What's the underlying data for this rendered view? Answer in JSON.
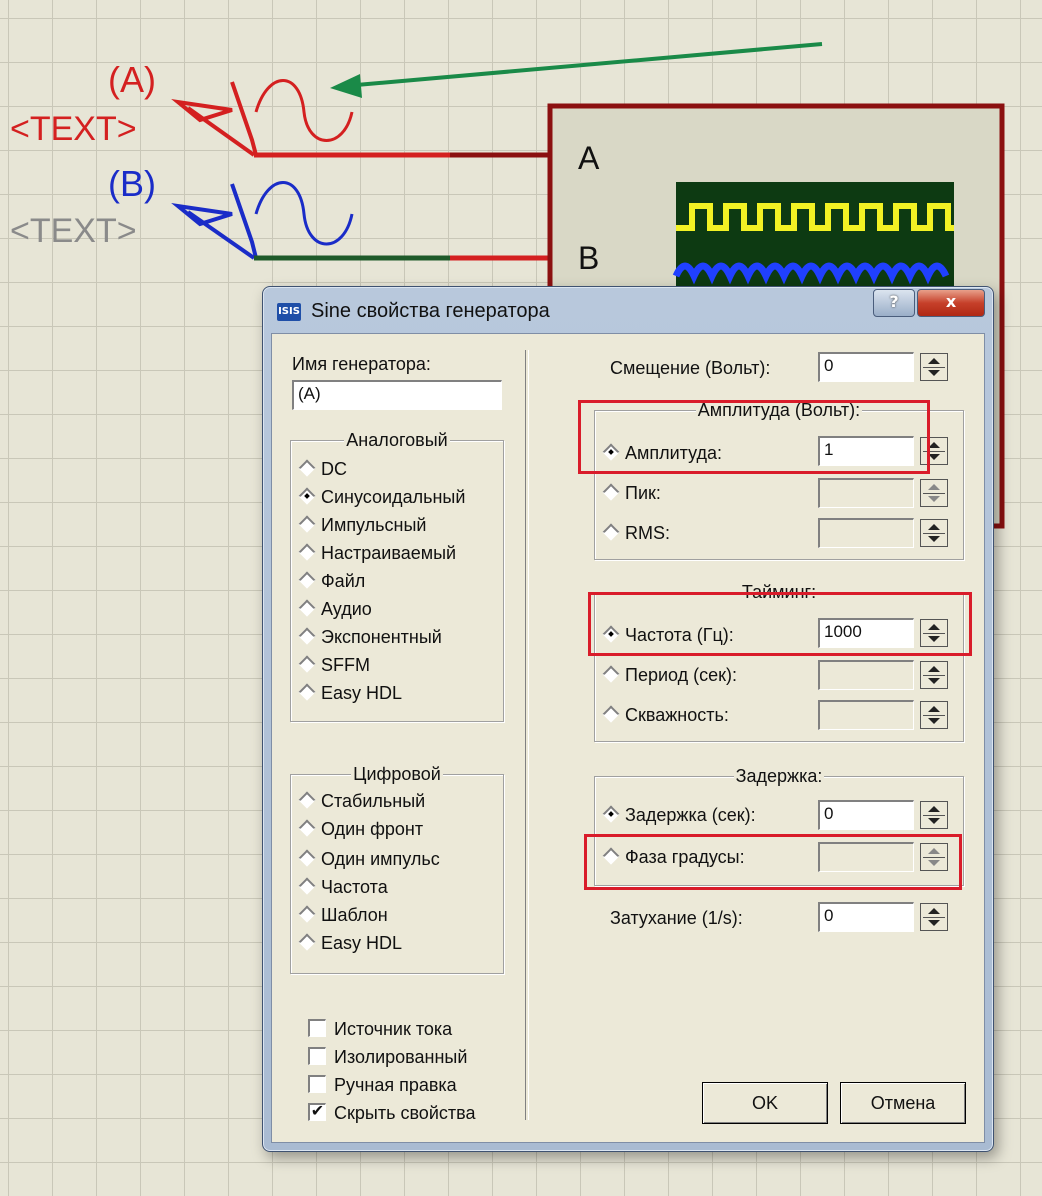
{
  "schematic": {
    "gen_a": {
      "name": "(A)",
      "text": "<TEXT>"
    },
    "gen_b": {
      "name": "(B)",
      "text": "<TEXT>"
    },
    "scope": {
      "channel_a": "A",
      "channel_b": "B"
    }
  },
  "dialog": {
    "icon_text": "ISIS",
    "title": "Sine свойства генератора",
    "help_label": "?",
    "close_label": "x",
    "generator_name_label": "Имя генератора:",
    "generator_name_value": "(A)",
    "analog": {
      "title": "Аналоговый",
      "options": [
        "DC",
        "Синусоидальный",
        "Импульсный",
        "Настраиваемый",
        "Файл",
        "Аудио",
        "Экспонентный",
        "SFFM",
        "Easy HDL"
      ],
      "selected": 1
    },
    "digital": {
      "title": "Цифровой",
      "options": [
        "Стабильный",
        "Один фронт",
        "Один импульс",
        "Частота",
        "Шаблон",
        "Easy HDL"
      ]
    },
    "checkboxes": [
      {
        "label": "Источник тока",
        "checked": false
      },
      {
        "label": "Изолированный",
        "checked": false
      },
      {
        "label": "Ручная правка",
        "checked": false
      },
      {
        "label": "Скрыть свойства",
        "checked": true,
        "mark": "✔"
      }
    ],
    "offset": {
      "label": "Смещение (Вольт):",
      "value": "0"
    },
    "amplitude_group": {
      "title": "Амплитуда (Вольт):",
      "amplitude": {
        "label": "Амплитуда:",
        "value": "1"
      },
      "peak": {
        "label": "Пик:",
        "value": ""
      },
      "rms": {
        "label": "RMS:",
        "value": ""
      }
    },
    "timing_group": {
      "title": "Тайминг:",
      "frequency": {
        "label": "Частота (Гц):",
        "value": "1000"
      },
      "period": {
        "label": "Период (сек):",
        "value": ""
      },
      "duty": {
        "label": "Скважность:",
        "value": ""
      }
    },
    "delay_group": {
      "title": "Задержка:",
      "delay": {
        "label": "Задержка (сек):",
        "value": "0"
      },
      "phase": {
        "label": "Фаза  градусы:",
        "value": ""
      }
    },
    "damping": {
      "label": "Затухание (1/s):",
      "value": "0"
    },
    "ok_label": "OK",
    "cancel_label": "Отмена"
  },
  "colors": {
    "wire_red": "#d42020",
    "wire_dark_red": "#8b1010",
    "wire_green": "#1f5a2a",
    "arrow_green": "#1a8a48",
    "scope_screen": "#0d3a12",
    "trace_yellow": "#f2f224",
    "trace_blue": "#2040ff",
    "highlight_red": "#d91c2a"
  }
}
